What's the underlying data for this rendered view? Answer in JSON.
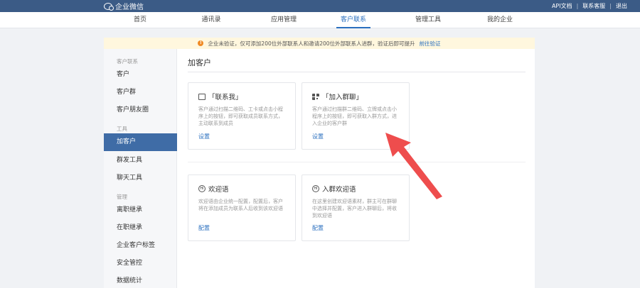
{
  "app": {
    "logo_text": "企业微信"
  },
  "top_links": [
    "API文档",
    "联系客服",
    "退出"
  ],
  "nav": [
    {
      "label": "首页",
      "active": false
    },
    {
      "label": "通讯录",
      "active": false
    },
    {
      "label": "应用管理",
      "active": false
    },
    {
      "label": "客户联系",
      "active": true
    },
    {
      "label": "管理工具",
      "active": false
    },
    {
      "label": "我的企业",
      "active": false
    }
  ],
  "notice": {
    "text": "企业未验证，仅可添加200位外部联系人和邀请200位外部联系人进群，验证后即可提升",
    "link": "前往验证"
  },
  "sidebar": {
    "groups": [
      "客户联系",
      "工具",
      "管理"
    ],
    "items": [
      "客户",
      "客户群",
      "客户朋友圈",
      "加客户",
      "群发工具",
      "聊天工具",
      "离职继承",
      "在职继承",
      "企业客户标签",
      "安全管控",
      "数据统计"
    ],
    "active": "加客户"
  },
  "main": {
    "title": "加客户",
    "cards": [
      {
        "icon": "contact-me-icon",
        "title": "「联系我」",
        "desc": "客户通过扫描二维码、工卡或点击小程序上的按钮，即可获取成员联系方式，主动联系到成员",
        "link": "设置"
      },
      {
        "icon": "qrcode-icon",
        "title": "「加入群聊」",
        "desc": "客户通过扫描群二维码、立牌或点击小程序上的按钮，即可获取入群方式，进入企业的客户群",
        "link": "设置"
      },
      {
        "icon": "welcome-icon",
        "title": "欢迎语",
        "desc": "欢迎语由企业统一配置，配置后，客户将在添加成员为联系人后收到该欢迎语",
        "link": "配置"
      },
      {
        "icon": "group-welcome-icon",
        "title": "入群欢迎语",
        "desc": "在这里创建欢迎语素材，群主可在群聊中选择并配置，客户进入群聊后，将收到欢迎语",
        "link": "配置"
      }
    ]
  },
  "colors": {
    "topbar": "#3b5b86",
    "accent": "#2a6fbf",
    "sidebar_active": "#3f6ca6",
    "arrow": "#ee4d4d"
  }
}
